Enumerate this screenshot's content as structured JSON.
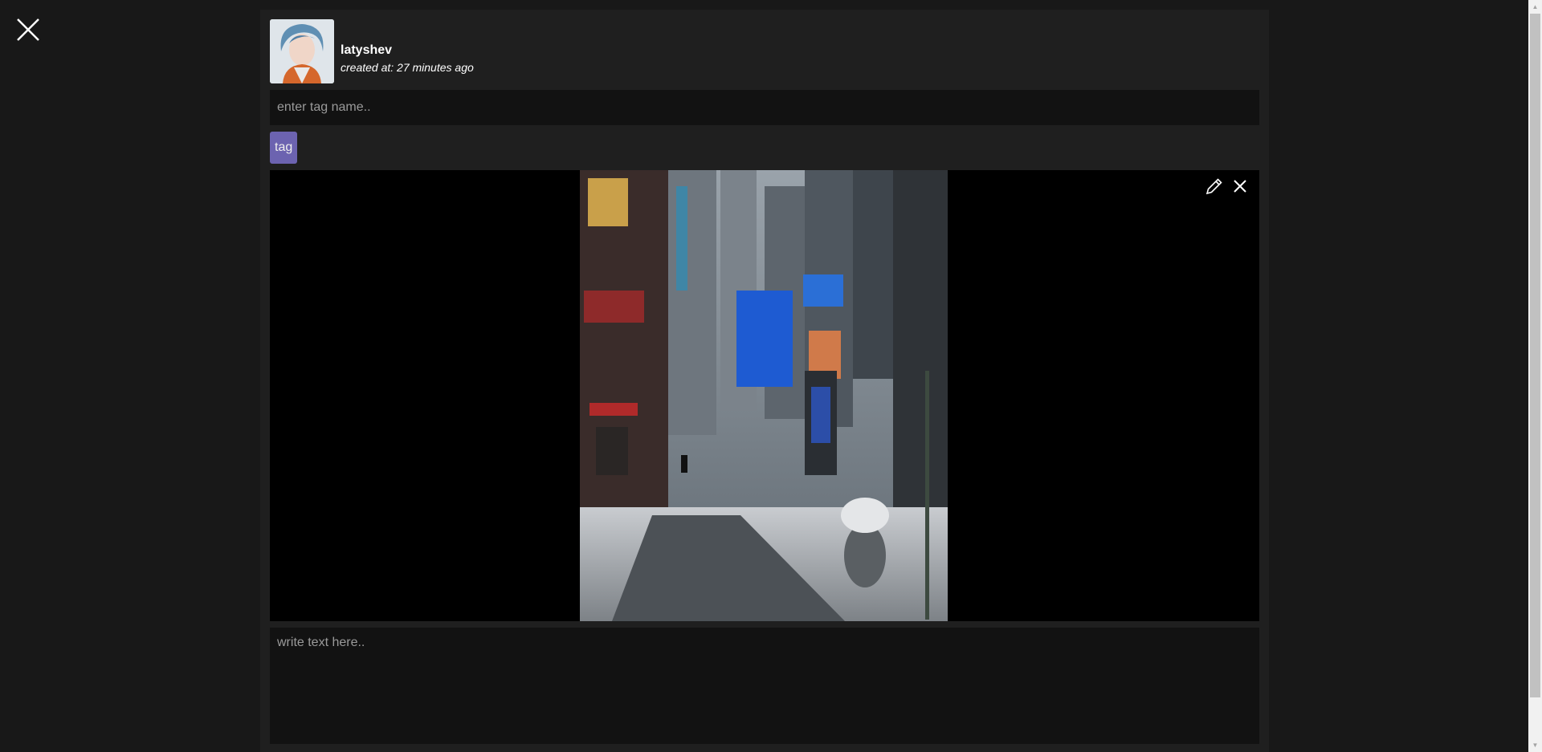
{
  "overlay": {
    "close_icon": "close-icon"
  },
  "post": {
    "author": "latyshev",
    "created_at": "created at: 27 minutes ago",
    "avatar_icon": "user-avatar"
  },
  "tag_input": {
    "placeholder": "enter tag name.."
  },
  "tags": [
    {
      "label": "tag"
    }
  ],
  "image": {
    "description_icon": "photo-times-square-snow",
    "edit_icon": "pencil-icon",
    "remove_icon": "close-icon"
  },
  "text_input": {
    "placeholder": "write text here.."
  },
  "colors": {
    "background": "#181818",
    "panel": "#1f1f1f",
    "input": "#121212",
    "tag_accent": "#6c63b0"
  }
}
